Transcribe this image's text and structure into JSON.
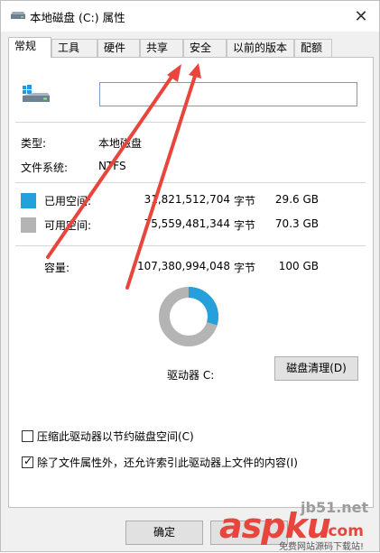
{
  "window": {
    "title": "本地磁盘 (C:) 属性",
    "close_glyph": "✕"
  },
  "tabs": [
    {
      "label": "常规",
      "active": true
    },
    {
      "label": "工具",
      "active": false
    },
    {
      "label": "硬件",
      "active": false
    },
    {
      "label": "共享",
      "active": false
    },
    {
      "label": "安全",
      "active": false
    },
    {
      "label": "以前的版本",
      "active": false
    },
    {
      "label": "配额",
      "active": false
    }
  ],
  "general": {
    "volume_name_value": "",
    "type_label": "类型:",
    "type_value": "本地磁盘",
    "fs_label": "文件系统:",
    "fs_value": "NTFS",
    "used": {
      "label": "已用空间:",
      "bytes": "31,821,512,704",
      "unit": "字节",
      "size": "29.6 GB",
      "color": "#26a0da"
    },
    "free": {
      "label": "可用空间:",
      "bytes": "75,559,481,344",
      "unit": "字节",
      "size": "70.3 GB",
      "color": "#b4b4b4"
    },
    "capacity": {
      "label": "容量:",
      "bytes": "107,380,994,048",
      "unit": "字节",
      "size": "100 GB"
    },
    "used_fraction": 0.296,
    "drive_label": "驱动器 C:",
    "cleanup_button": "磁盘清理(D)",
    "compress_option": {
      "label": "压缩此驱动器以节约磁盘空间(C)",
      "checked": false
    },
    "index_option": {
      "label": "除了文件属性外，还允许索引此驱动器上文件的内容(I)",
      "checked": true
    }
  },
  "footer": {
    "ok_button": "确定"
  },
  "overlay": {
    "arrow_color": "#e8453c",
    "watermark_domain": "jb51.net",
    "watermark_brand": "aspku",
    "watermark_tld": ".com",
    "watermark_caption": "免费网站源码下载站!"
  },
  "icons": {
    "title_icon": "drive-icon",
    "drive_icon": "windows-drive-icon"
  }
}
